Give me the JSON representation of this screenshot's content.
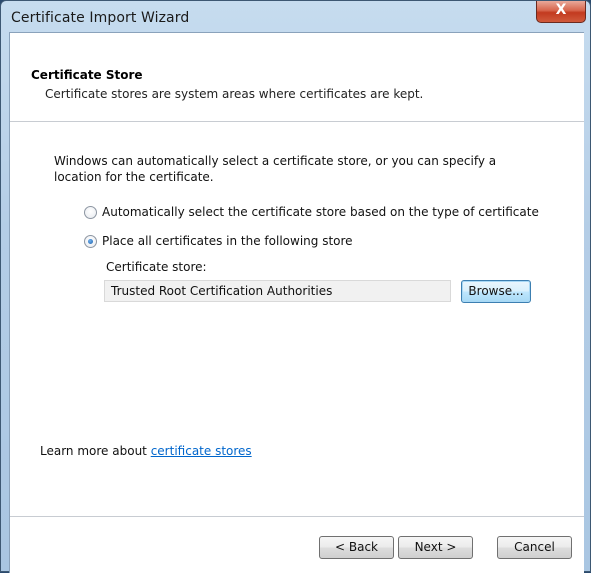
{
  "window": {
    "title": "Certificate Import Wizard",
    "close_glyph": "X"
  },
  "header": {
    "title": "Certificate Store",
    "description": "Certificate stores are system areas where certificates are kept."
  },
  "body": {
    "intro": "Windows can automatically select a certificate store, or you can specify a location for the certificate.",
    "options": [
      {
        "label": "Automatically select the certificate store based on the type of certificate",
        "checked": false
      },
      {
        "label": "Place all certificates in the following store",
        "checked": true
      }
    ],
    "store_label": "Certificate store:",
    "store_value": "Trusted Root Certification Authorities",
    "browse_label": "Browse..."
  },
  "learn_more": {
    "prefix": "Learn more about ",
    "link": "certificate stores"
  },
  "footer": {
    "back_label": "< Back",
    "next_label": "Next >",
    "cancel_label": "Cancel"
  },
  "colors": {
    "link": "#0066cc",
    "close_button": "#c23a1f",
    "title_bar": "#b4cde6"
  }
}
